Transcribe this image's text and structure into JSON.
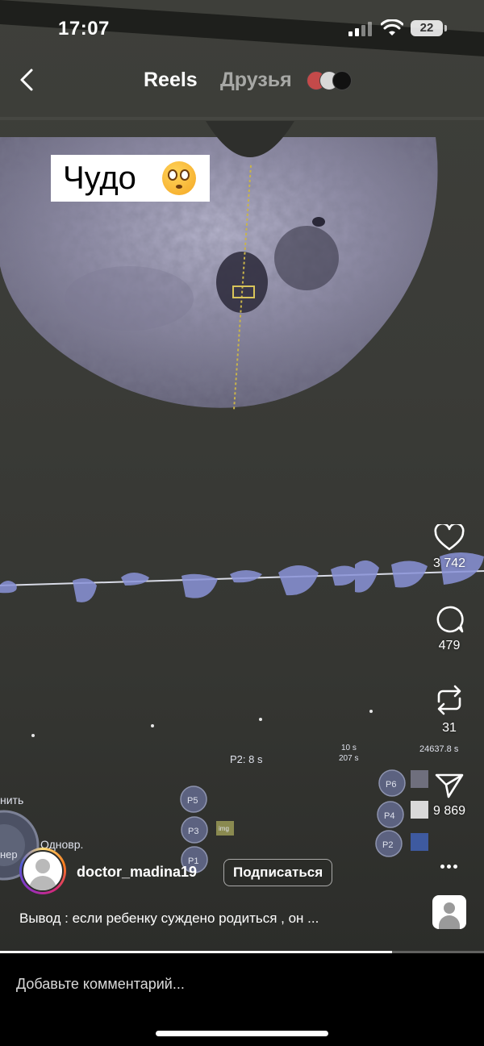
{
  "status_bar": {
    "time": "17:07",
    "battery": "22"
  },
  "nav": {
    "tab_reels": "Reels",
    "tab_friends": "Друзья"
  },
  "video": {
    "sticker_text": "Чудо",
    "sticker_emoji": "flushed-face-emoji",
    "screen_labels": {
      "p2": "P2:  8 s",
      "t1": "10 s",
      "t2": "207 s",
      "t3": "24637.8 s",
      "p5": "P5",
      "p3": "P3",
      "p4": "P4",
      "p6": "P6",
      "p2b": "P2",
      "p1": "P1",
      "img": "img",
      "left_word1": "нить",
      "left_word2": "Одновр.",
      "left_word3": "нер"
    }
  },
  "actions": {
    "likes": "3 742",
    "comments": "479",
    "reposts": "31",
    "shares": "9 869"
  },
  "author": {
    "username": "doctor_madina19",
    "follow_label": "Подписаться",
    "caption": "Вывод : если ребенку суждено родиться , он ..."
  },
  "playback": {
    "progress": 0.81
  },
  "comment_box": {
    "placeholder": "Добавьте комментарий..."
  },
  "icons": [
    "back-icon",
    "heart-icon",
    "comment-icon",
    "repost-icon",
    "send-icon",
    "more-icon",
    "wifi-icon",
    "signal-icon",
    "battery-icon"
  ]
}
